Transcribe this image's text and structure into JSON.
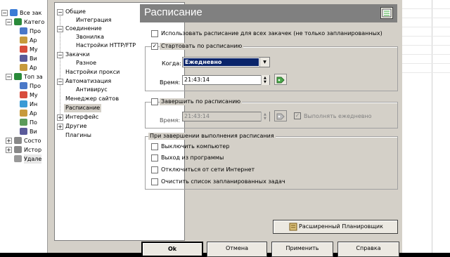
{
  "background_tree": {
    "items": [
      "Все зак",
      "Катего",
      "Про",
      "Ар",
      "Му",
      "Ви",
      "Ар",
      "Топ за",
      "Про",
      "Му",
      "Ин",
      "Ар",
      "По",
      "Ви",
      "Состо",
      "Истор",
      "Удале"
    ]
  },
  "nav": {
    "items": [
      "Общие",
      "Интеграция",
      "Соединение",
      "Звонилка",
      "Настройки HTTP/FTP",
      "Закачки",
      "Разное",
      "Настройки прокси",
      "Автоматизация",
      "Антивирус",
      "Менеджер сайтов",
      "Расписание",
      "Интерфейс",
      "Другие",
      "Плагины"
    ],
    "selected": "Расписание"
  },
  "panel": {
    "title": "Расписание",
    "use_schedule_all": "Использовать расписание для всех закачек (не только запланированных)",
    "start_group": "Стартовать по расписанию",
    "when_label": "Когда:",
    "when_value": "Ежедневно",
    "time_label": "Время:",
    "start_time": "21:43:14",
    "stop_group": "Завершить по расписанию",
    "stop_time": "21:43:14",
    "daily_label": "Выполнять ежедневно",
    "on_finish_group": "При завершении выполнения расписания",
    "opt_shutdown": "Выключить компьютер",
    "opt_exit": "Выход из программы",
    "opt_disconnect": "Отключиться от сети Интернет",
    "opt_clear": "Очистить список запланированных задач",
    "advanced_button": "Расширенный Планировщик"
  },
  "buttons": {
    "ok": "Ok",
    "cancel": "Отмена",
    "apply": "Применить",
    "help": "Справка"
  },
  "colors": {
    "header": "#808080",
    "selection": "#0a246a",
    "dialog": "#d4d0c8"
  }
}
